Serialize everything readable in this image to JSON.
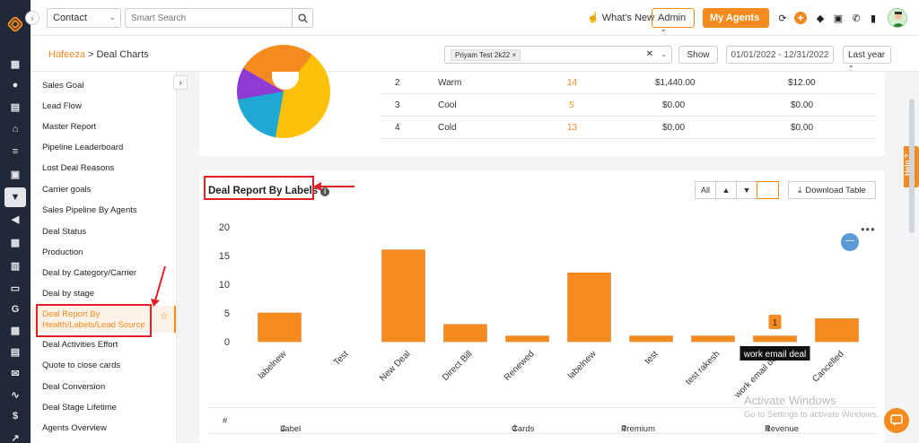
{
  "topbar": {
    "contact_select": "Contact",
    "search_placeholder": "Smart Search",
    "whats_new": "What's New",
    "admin_select": "Admin",
    "my_agents": "My Agents"
  },
  "subheader": {
    "breadcrumb_root": "Hafeeza",
    "breadcrumb_sep": ">",
    "breadcrumb_current": "Deal Charts",
    "filter_chip": "Priyam Test 2k22",
    "show_button": "Show",
    "date_range": "01/01/2022 - 12/31/2022",
    "period_select": "Last year"
  },
  "sidebar": {
    "items": [
      "Sales Goal",
      "Lead Flow",
      "Master Report",
      "Pipeline Leaderboard",
      "Lost Deal Reasons",
      "Carrier goals",
      "Sales Pipeline By Agents",
      "Deal Status",
      "Production",
      "Deal by Category/Carrier",
      "Deal by stage",
      "Deal Report By Health/Labels/Lead Source",
      "Deal Activities Effort",
      "Quote to close cards",
      "Deal Conversion",
      "Deal Stage Lifetime",
      "Agents Overview"
    ],
    "active_line1": "Deal Report By",
    "active_line2": "Health/Labels/Lead Source"
  },
  "health_table": {
    "rows": [
      {
        "no": "2",
        "label": "Warm",
        "cards": "14",
        "premium": "$1,440.00",
        "revenue": "$12.00"
      },
      {
        "no": "3",
        "label": "Cool",
        "cards": "5",
        "premium": "$0.00",
        "revenue": "$0.00"
      },
      {
        "no": "4",
        "label": "Cold",
        "cards": "13",
        "premium": "$0.00",
        "revenue": "$0.00"
      }
    ]
  },
  "labels_card": {
    "title": "Deal Report By Labels",
    "filter_all": "All",
    "download": "Download Table",
    "tooltip_value": "1",
    "tooltip_label": "work email deal",
    "table_headers": {
      "no": "#",
      "label": "Label",
      "cards": "Cards",
      "premium": "Premium",
      "revenue": "Revenue"
    },
    "help_tab": "Help",
    "watermark_title": "Activate Windows",
    "watermark_sub": "Go to Settings to activate Windows."
  },
  "colors": {
    "accent": "#f58a1f",
    "bar": "#f58a1f",
    "annotation": "#e31e24"
  },
  "chart_data": {
    "type": "bar",
    "title": "Deal Report By Labels",
    "categories": [
      "labelnew",
      "Test",
      "New Deal",
      "Direct Bill",
      "Renewed",
      "labelnew",
      "test",
      "test rakesh",
      "work email deal",
      "Cancelled"
    ],
    "values": [
      5,
      0,
      16,
      3,
      1,
      12,
      1,
      1,
      1,
      4
    ],
    "yticks": [
      0,
      5,
      10,
      15,
      20
    ],
    "ylim": [
      0,
      20
    ],
    "grid": false,
    "legend": "none"
  }
}
